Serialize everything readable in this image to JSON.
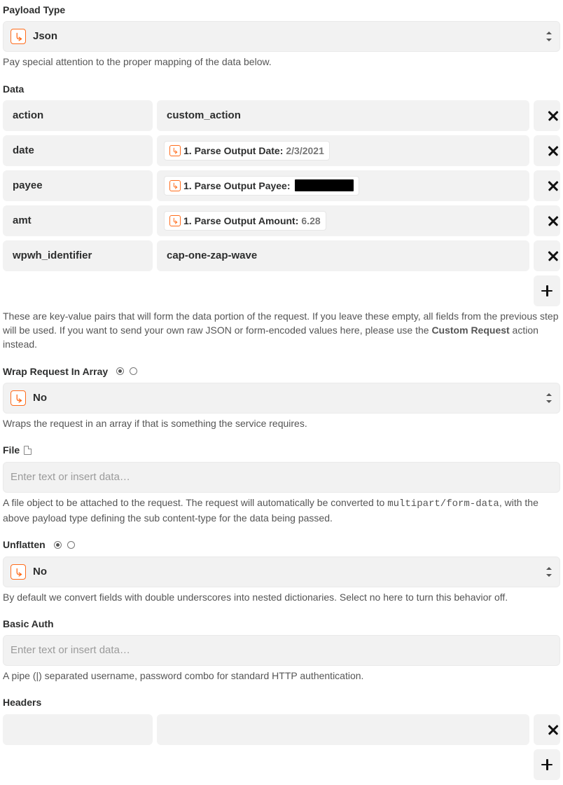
{
  "payload_type": {
    "label": "Payload Type",
    "value": "Json",
    "help": "Pay special attention to the proper mapping of the data below."
  },
  "data": {
    "label": "Data",
    "rows": [
      {
        "key": "action",
        "type": "text",
        "text": "custom_action"
      },
      {
        "key": "date",
        "type": "pill",
        "prefix": "1. Parse Output Date:",
        "value": " 2/3/2021"
      },
      {
        "key": "payee",
        "type": "pill_black",
        "prefix": "1. Parse Output Payee:"
      },
      {
        "key": "amt",
        "type": "pill",
        "prefix": "1. Parse Output Amount:",
        "value": " 6.28"
      },
      {
        "key": "wpwh_identifier",
        "type": "text",
        "text": "cap-one-zap-wave"
      }
    ],
    "help_pre": "These are key-value pairs that will form the data portion of the request. If you leave these empty, all fields from the previous step will be used. If you want to send your own raw JSON or form-encoded values here, please use the ",
    "help_bold": "Custom Request",
    "help_post": " action instead."
  },
  "wrap": {
    "label": "Wrap Request In Array",
    "value": "No",
    "help": "Wraps the request in an array if that is something the service requires."
  },
  "file": {
    "label": "File",
    "placeholder": "Enter text or insert data…",
    "help_pre": "A file object to be attached to the request. The request will automatically be converted to ",
    "help_code": "multipart/form-data",
    "help_post": ", with the above payload type defining the sub content-type for the data being passed."
  },
  "unflatten": {
    "label": "Unflatten",
    "value": "No",
    "help": "By default we convert fields with double underscores into nested dictionaries. Select no here to turn this behavior off."
  },
  "basic_auth": {
    "label": "Basic Auth",
    "placeholder": "Enter text or insert data…",
    "help": "A pipe (|) separated username, password combo for standard HTTP authentication."
  },
  "headers": {
    "label": "Headers"
  }
}
